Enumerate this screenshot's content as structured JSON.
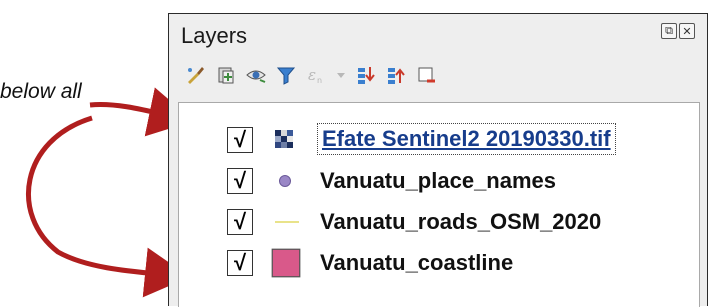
{
  "annotation": {
    "text": "below all"
  },
  "panel": {
    "title": "Layers",
    "title_buttons": [
      "float-icon",
      "close-icon"
    ],
    "toolbar": [
      "style-manager-icon",
      "add-group-icon",
      "manage-visibility-icon",
      "filter-legend-icon",
      "filter-expression-icon",
      "expand-all-icon",
      "collapse-all-icon",
      "remove-layer-icon"
    ]
  },
  "layers": [
    {
      "name": "Efate Sentinel2 20190330.tif",
      "checked": "√",
      "icon": "raster-icon",
      "selected": true
    },
    {
      "name": "Vanuatu_place_names",
      "checked": "√",
      "icon": "point-icon",
      "color": "#9a87c6"
    },
    {
      "name": "Vanuatu_roads_OSM_2020",
      "checked": "√",
      "icon": "line-icon",
      "color": "#e9e38a"
    },
    {
      "name": "Vanuatu_coastline",
      "checked": "√",
      "icon": "polygon-icon",
      "color": "#d9598a"
    }
  ],
  "colors": {
    "arrow": "#b01e1e",
    "selected_text": "#173d8c"
  }
}
